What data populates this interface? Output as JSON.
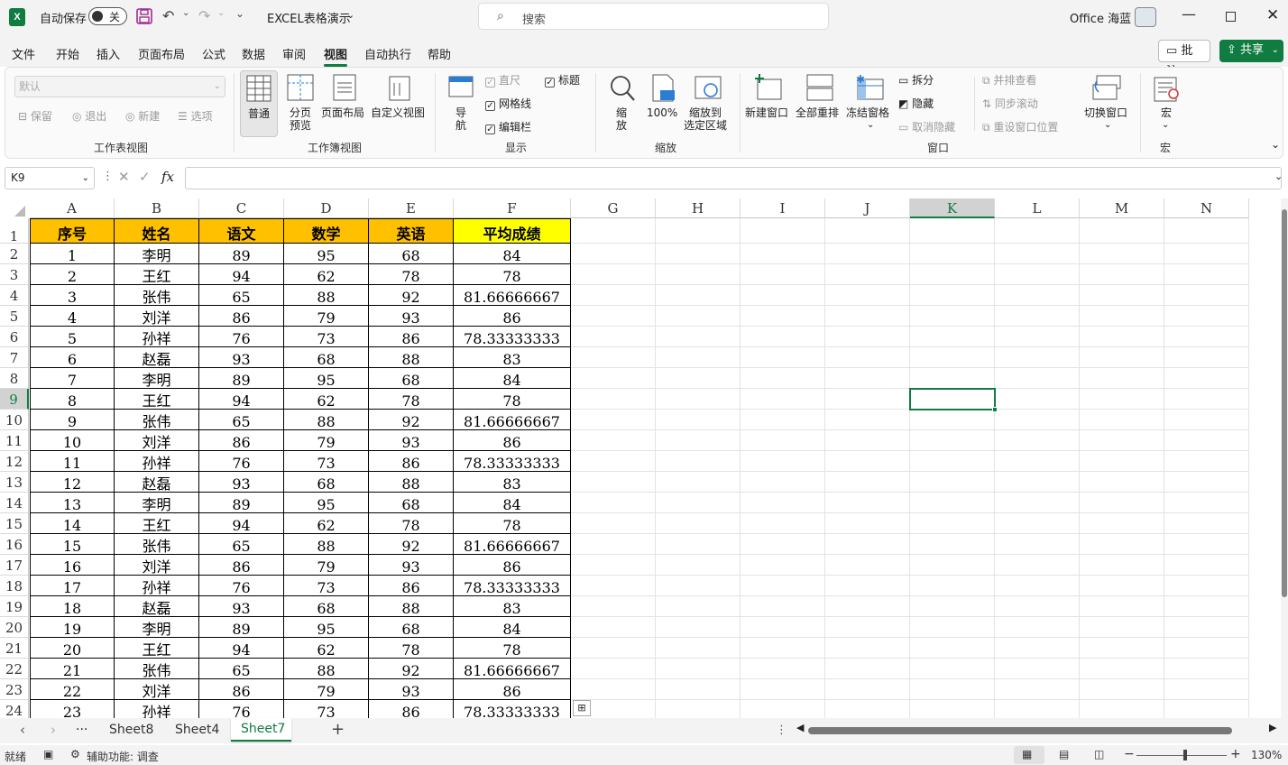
{
  "titlebar": {
    "app_icon": "X",
    "autosave_label": "自动保存",
    "autosave_state": "关",
    "doc_title": "EXCEL表格演示",
    "search_placeholder": "搜索",
    "user_name": "Office 海蓝"
  },
  "tabs": [
    {
      "label": "文件"
    },
    {
      "label": "开始"
    },
    {
      "label": "插入"
    },
    {
      "label": "页面布局"
    },
    {
      "label": "公式"
    },
    {
      "label": "数据"
    },
    {
      "label": "审阅"
    },
    {
      "label": "视图"
    },
    {
      "label": "自动执行"
    },
    {
      "label": "帮助"
    }
  ],
  "active_tab": "视图",
  "comment_button": "批注",
  "share_button": "共享",
  "ribbon": {
    "sheet_view": {
      "dropdown_value": "默认",
      "keep": "保留",
      "exit": "退出",
      "new": "新建",
      "options": "选项",
      "group": "工作表视图"
    },
    "workbook_view": {
      "normal": "普通",
      "page_break_1": "分页",
      "page_break_2": "预览",
      "page_layout": "页面布局",
      "custom": "自定义视图",
      "group": "工作簿视图"
    },
    "show": {
      "ruler": "直尺",
      "gridlines": "网格线",
      "formula_bar": "编辑栏",
      "headings": "标题",
      "nav_1": "导",
      "nav_2": "航",
      "group": "显示"
    },
    "zoom": {
      "zoom_1": "缩",
      "zoom_2": "放",
      "hundred": "100%",
      "to_sel_1": "缩放到",
      "to_sel_2": "选定区域",
      "group": "缩放"
    },
    "window": {
      "new_window": "新建窗口",
      "arrange_all": "全部重排",
      "freeze": "冻结窗格",
      "split": "拆分",
      "hide": "隐藏",
      "unhide": "取消隐藏",
      "side_by_side": "并排查看",
      "sync_scroll": "同步滚动",
      "reset_pos": "重设窗口位置",
      "switch": "切换窗口",
      "group": "窗口"
    },
    "macros": {
      "label": "宏",
      "group": "宏"
    }
  },
  "formula_bar": {
    "name_box": "K9",
    "fx": "fx",
    "formula": ""
  },
  "columns": [
    "A",
    "B",
    "C",
    "D",
    "E",
    "F",
    "G",
    "H",
    "I",
    "J",
    "K",
    "L",
    "M",
    "N"
  ],
  "selected_cell": "K9",
  "table": {
    "headers": [
      "序号",
      "姓名",
      "语文",
      "数学",
      "英语",
      "平均成绩"
    ],
    "header_color": "#FFC000",
    "avg_header_color": "#FFFF00",
    "rows": [
      [
        "1",
        "李明",
        "89",
        "95",
        "68",
        "84"
      ],
      [
        "2",
        "王红",
        "94",
        "62",
        "78",
        "78"
      ],
      [
        "3",
        "张伟",
        "65",
        "88",
        "92",
        "81.66666667"
      ],
      [
        "4",
        "刘洋",
        "86",
        "79",
        "93",
        "86"
      ],
      [
        "5",
        "孙祥",
        "76",
        "73",
        "86",
        "78.33333333"
      ],
      [
        "6",
        "赵磊",
        "93",
        "68",
        "88",
        "83"
      ],
      [
        "7",
        "李明",
        "89",
        "95",
        "68",
        "84"
      ],
      [
        "8",
        "王红",
        "94",
        "62",
        "78",
        "78"
      ],
      [
        "9",
        "张伟",
        "65",
        "88",
        "92",
        "81.66666667"
      ],
      [
        "10",
        "刘洋",
        "86",
        "79",
        "93",
        "86"
      ],
      [
        "11",
        "孙祥",
        "76",
        "73",
        "86",
        "78.33333333"
      ],
      [
        "12",
        "赵磊",
        "93",
        "68",
        "88",
        "83"
      ],
      [
        "13",
        "李明",
        "89",
        "95",
        "68",
        "84"
      ],
      [
        "14",
        "王红",
        "94",
        "62",
        "78",
        "78"
      ],
      [
        "15",
        "张伟",
        "65",
        "88",
        "92",
        "81.66666667"
      ],
      [
        "16",
        "刘洋",
        "86",
        "79",
        "93",
        "86"
      ],
      [
        "17",
        "孙祥",
        "76",
        "73",
        "86",
        "78.33333333"
      ],
      [
        "18",
        "赵磊",
        "93",
        "68",
        "88",
        "83"
      ],
      [
        "19",
        "李明",
        "89",
        "95",
        "68",
        "84"
      ],
      [
        "20",
        "王红",
        "94",
        "62",
        "78",
        "78"
      ],
      [
        "21",
        "张伟",
        "65",
        "88",
        "92",
        "81.66666667"
      ],
      [
        "22",
        "刘洋",
        "86",
        "79",
        "93",
        "86"
      ],
      [
        "23",
        "孙祥",
        "76",
        "73",
        "86",
        "78.33333333"
      ]
    ]
  },
  "sheets": [
    {
      "name": "Sheet8"
    },
    {
      "name": "Sheet4"
    },
    {
      "name": "Sheet7"
    }
  ],
  "active_sheet": "Sheet7",
  "sheet_more": "···",
  "status": {
    "ready": "就绪",
    "accessibility": "辅助功能: 调查",
    "zoom": "130%"
  }
}
